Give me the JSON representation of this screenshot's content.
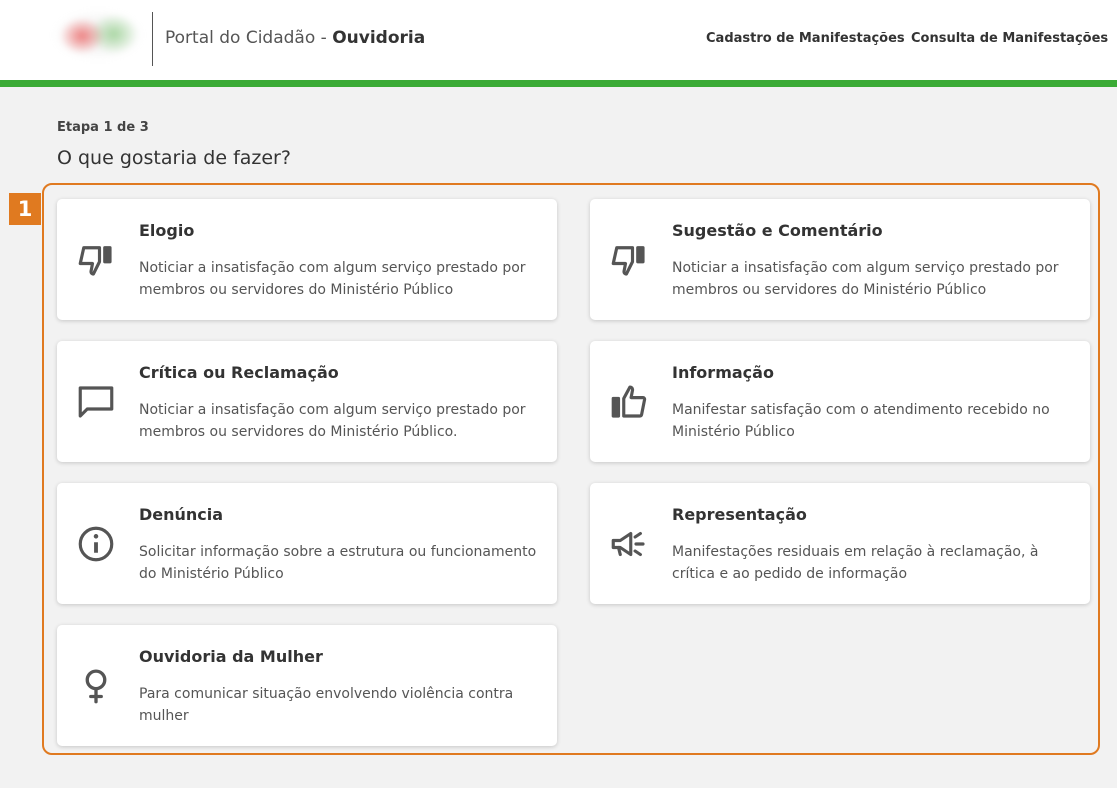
{
  "header": {
    "title_prefix": "Portal do Cidadão - ",
    "title_bold": "Ouvidoria",
    "nav": [
      {
        "label": "Cadastro de Manifestações"
      },
      {
        "label": "Consulta de Manifestações"
      }
    ]
  },
  "step": "Etapa 1 de 3",
  "question": "O que gostaria de fazer?",
  "badge": "1",
  "cards": [
    {
      "title": "Elogio",
      "description": "Noticiar a insatisfação com algum serviço prestado por membros ou servidores do Ministério Público",
      "icon": "thumbs-down-icon"
    },
    {
      "title": "Sugestão e Comentário",
      "description": "Noticiar a insatisfação com algum serviço prestado por membros ou servidores do Ministério Público",
      "icon": "thumbs-down-icon"
    },
    {
      "title": "Crítica ou Reclamação",
      "description": "Noticiar a insatisfação com algum serviço prestado por membros ou servidores do Ministério Público.",
      "icon": "chat-bubble-icon"
    },
    {
      "title": "Informação",
      "description": "Manifestar satisfação com o atendimento recebido no Ministério Público",
      "icon": "thumbs-up-icon"
    },
    {
      "title": "Denúncia",
      "description": "Solicitar informação sobre a estrutura ou funcionamento do Ministério Público",
      "icon": "info-icon"
    },
    {
      "title": "Representação",
      "description": "Manifestações residuais em relação à reclamação, à crítica e ao pedido de informação",
      "icon": "megaphone-icon"
    },
    {
      "title": "Ouvidoria da Mulher",
      "description": "Para comunicar situação envolvendo violência contra mulher",
      "icon": "female-symbol-icon"
    }
  ],
  "colors": {
    "accent_green": "#3bab36",
    "highlight_orange": "#e07a20"
  }
}
